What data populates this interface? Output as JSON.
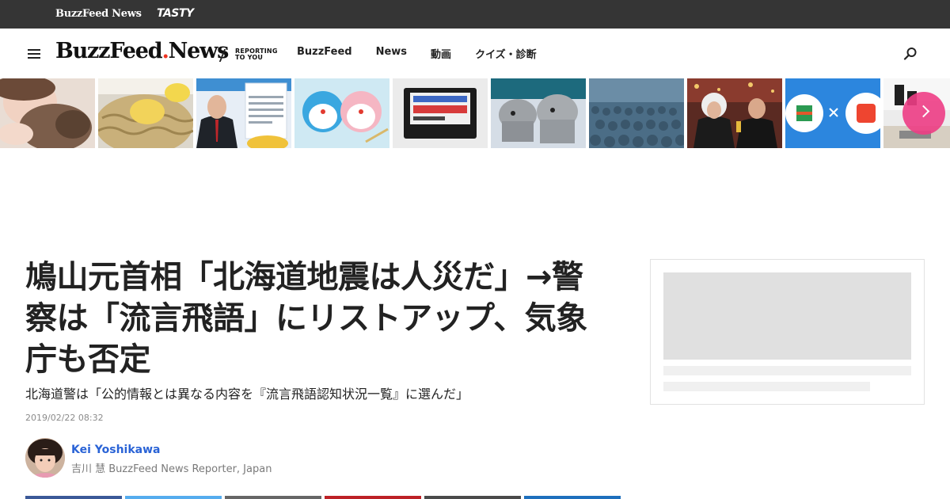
{
  "network_bar": {
    "brand_news": "BuzzFeed News",
    "brand_tasty": "TASTY"
  },
  "header": {
    "logo_main": "BuzzFeed",
    "logo_suffix": "News",
    "tagline": "REPORTING\nTO YOU",
    "nav": [
      {
        "label": "BuzzFeed"
      },
      {
        "label": "News"
      },
      {
        "label": "動画"
      },
      {
        "label": "クイズ・診断"
      }
    ]
  },
  "thumbnails": [
    {
      "icon": "person-with-cat-photo"
    },
    {
      "icon": "noodle-dish-photo"
    },
    {
      "icon": "politician-portrait-photo"
    },
    {
      "icon": "doraemon-sweets-photo"
    },
    {
      "icon": "famicom-cartridge-photo"
    },
    {
      "icon": "robot-dogs-photo"
    },
    {
      "icon": "crowd-photo"
    },
    {
      "icon": "award-ceremony-photo"
    },
    {
      "icon": "convenience-store-logos-photo"
    },
    {
      "icon": "storefront-sign-photo"
    }
  ],
  "article": {
    "headline": "鳩山元首相「北海道地震は人災だ」→警察は「流言飛語」にリストアップ、気象庁も否定",
    "dek": "北海道警は「公的情報とは異なる内容を『流言飛語認知状況一覧』に選んだ」",
    "timestamp": "2019/02/22 08:32",
    "author": {
      "name": "Kei Yoshikawa",
      "role": "吉川 慧 BuzzFeed News Reporter, Japan"
    }
  },
  "colors": {
    "topbar": "#353535",
    "logo_dot": "#e32222",
    "author_link": "#2a63d6",
    "carousel_next": "#ee3d85",
    "share_facebook": "#3b5998",
    "share_twitter": "#55acee",
    "share_line": "#666666",
    "share_pinterest": "#bd2126",
    "share_hatena": "#4a4a4a",
    "share_linkedin": "#1e6fbd"
  }
}
